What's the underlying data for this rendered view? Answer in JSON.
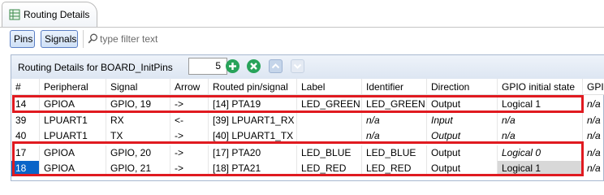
{
  "window": {
    "tab_title": "Routing Details"
  },
  "toolbar": {
    "pins_label": "Pins",
    "signals_label": "Signals",
    "filter_placeholder": "type filter text"
  },
  "panel": {
    "title": "Routing Details for BOARD_InitPins",
    "count": "5"
  },
  "table": {
    "headers": [
      "#",
      "Peripheral",
      "Signal",
      "Arrow",
      "Routed pin/signal",
      "Label",
      "Identifier",
      "Direction",
      "GPIO initial state",
      "GPIO"
    ],
    "rows": [
      [
        "14",
        "GPIOA",
        "GPIO, 19",
        "->",
        "[14] PTA19",
        "LED_GREEN",
        "LED_GREEN",
        "Output",
        "Logical 1",
        "n/a"
      ],
      [
        "39",
        "LPUART1",
        "RX",
        "<-",
        "[39] LPUART1_RX",
        "",
        "n/a",
        "Input",
        "n/a",
        "n/a"
      ],
      [
        "40",
        "LPUART1",
        "TX",
        "->",
        "[40] LPUART1_TX",
        "",
        "n/a",
        "Output",
        "n/a",
        "n/a"
      ],
      [
        "17",
        "GPIOA",
        "GPIO, 20",
        "->",
        "[17] PTA20",
        "LED_BLUE",
        "LED_BLUE",
        "Output",
        "Logical 0",
        "n/a"
      ],
      [
        "18",
        "GPIOA",
        "GPIO, 21",
        "->",
        "[18] PTA21",
        "LED_RED",
        "LED_RED",
        "Output",
        "Logical 1",
        "n/a"
      ]
    ]
  },
  "colors": {
    "highlight": "#e01a20",
    "selection": "#0a64c8",
    "accent_green": "#28a35a"
  }
}
